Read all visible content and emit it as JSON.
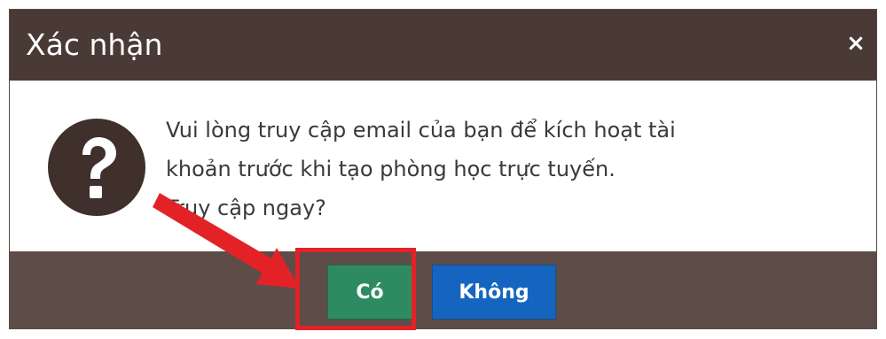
{
  "dialog": {
    "title": "Xác nhận",
    "close_symbol": "×",
    "icon": "question-icon",
    "message_lines": [
      "Vui lòng truy cập email của bạn để kích hoạt tài",
      "khoản trước khi tạo phòng học trực tuyến.",
      "Truy cập ngay?"
    ],
    "buttons": {
      "yes_label": "Có",
      "no_label": "Không"
    }
  },
  "annotation": {
    "arrow_icon": "red-arrow-icon",
    "highlight": "red-box-highlight"
  },
  "colors": {
    "titlebar": "#4a3a36",
    "footer": "#5d4c48",
    "yes_button": "#2e8b61",
    "no_button": "#1565c0",
    "highlight": "#e32227"
  }
}
